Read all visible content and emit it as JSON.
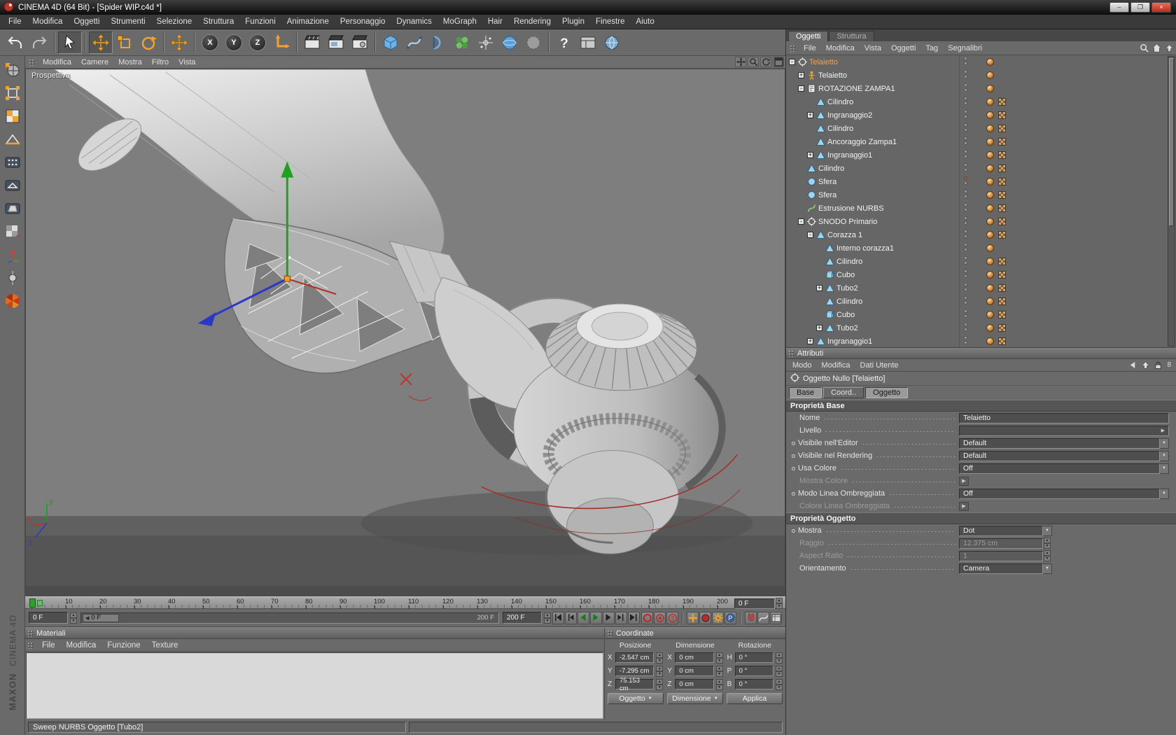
{
  "titlebar": {
    "title": "CINEMA 4D (64 Bit) - [Spider WIP.c4d *]",
    "window_buttons": [
      {
        "name": "minimize",
        "glyph": "–"
      },
      {
        "name": "restore",
        "glyph": "❐"
      },
      {
        "name": "close",
        "glyph": "×"
      }
    ]
  },
  "menubar": [
    "File",
    "Modifica",
    "Oggetti",
    "Strumenti",
    "Selezione",
    "Struttura",
    "Funzioni",
    "Animazione",
    "Personaggio",
    "Dynamics",
    "MoGraph",
    "Hair",
    "Rendering",
    "Plugin",
    "Finestre",
    "Aiuto"
  ],
  "toolbar": {
    "buttons": [
      {
        "name": "undo",
        "icon": "undo"
      },
      {
        "name": "redo",
        "icon": "redo"
      },
      {
        "sep": true
      },
      {
        "name": "live-selection",
        "icon": "cursor",
        "pressed": true
      },
      {
        "sep": true
      },
      {
        "name": "move-tool",
        "icon": "move",
        "pressed": true
      },
      {
        "name": "scale-tool",
        "icon": "scale"
      },
      {
        "name": "rotate-tool",
        "icon": "rotate"
      },
      {
        "sep": true
      },
      {
        "name": "last-tool",
        "icon": "move"
      },
      {
        "sep": true
      },
      {
        "name": "lock-x",
        "letter": "X"
      },
      {
        "name": "lock-y",
        "letter": "Y"
      },
      {
        "name": "lock-z",
        "letter": "Z"
      },
      {
        "name": "coord-system",
        "icon": "coordsys"
      },
      {
        "sep": true
      },
      {
        "name": "render-view",
        "icon": "clapper"
      },
      {
        "name": "render-picture-viewer",
        "icon": "clapper-pic"
      },
      {
        "name": "render-settings",
        "icon": "clapper-gear"
      },
      {
        "sep": true
      },
      {
        "name": "add-primitive",
        "icon": "cube"
      },
      {
        "name": "add-spline",
        "icon": "spline"
      },
      {
        "name": "add-nurbs",
        "icon": "nurbs"
      },
      {
        "name": "add-modeling",
        "icon": "modeling"
      },
      {
        "name": "add-particle",
        "icon": "particle"
      },
      {
        "name": "add-scene",
        "icon": "scene"
      },
      {
        "name": "add-deformer",
        "icon": "deformer"
      },
      {
        "sep": true
      },
      {
        "name": "help",
        "icon": "help"
      },
      {
        "name": "layout",
        "icon": "layout"
      },
      {
        "name": "content-browser",
        "icon": "globe"
      }
    ]
  },
  "left_toolbar": [
    "make-editable",
    "model-mode",
    "texture-mode",
    "workplane-mode",
    "points-mode",
    "edges-mode",
    "polygons-mode",
    "texture-axis-mode",
    "object-axis-mode",
    "keyframe-mode",
    "viewport-fan"
  ],
  "viewport": {
    "menu": [
      "Modifica",
      "Camere",
      "Mostra",
      "Filtro",
      "Vista"
    ],
    "view_icons": [
      "pan-view",
      "zoom-view",
      "rotate-view",
      "toggle-view"
    ],
    "camera_label": "Prospettiva"
  },
  "object_manager": {
    "tabs": [
      {
        "label": "Oggetti",
        "active": true
      },
      {
        "label": "Struttura",
        "active": false
      }
    ],
    "menu": [
      "File",
      "Modifica",
      "Vista",
      "Oggetti",
      "Tag",
      "Segnalibri"
    ],
    "corner_icons": [
      "search",
      "home",
      "up"
    ],
    "tree": [
      {
        "label": "Telaietto",
        "depth": 0,
        "expand": "-",
        "icon": "null",
        "selected": true,
        "tags": [
          "material"
        ]
      },
      {
        "label": "Telaietto",
        "depth": 1,
        "expand": "+",
        "icon": "figure",
        "tags": [
          "material"
        ]
      },
      {
        "label": "ROTAZIONE ZAMPA1",
        "depth": 1,
        "expand": "-",
        "icon": "note",
        "tags": [
          "material"
        ]
      },
      {
        "label": "Cilindro",
        "depth": 2,
        "icon": "cone",
        "tags": [
          "material",
          "uvw"
        ]
      },
      {
        "label": "Ingranaggio2",
        "depth": 2,
        "expand": "+",
        "icon": "cone",
        "tags": [
          "material",
          "uvw"
        ]
      },
      {
        "label": "Cilindro",
        "depth": 2,
        "icon": "cone",
        "tags": [
          "material",
          "uvw"
        ]
      },
      {
        "label": "Ancoraggio Zampa1",
        "depth": 2,
        "icon": "cone",
        "tags": [
          "material",
          "uvw"
        ]
      },
      {
        "label": "Ingranaggio1",
        "depth": 2,
        "expand": "+",
        "icon": "cone",
        "tags": [
          "material",
          "uvw"
        ]
      },
      {
        "label": "Cilindro",
        "depth": 1,
        "icon": "cone",
        "tags": [
          "material",
          "uvw"
        ]
      },
      {
        "label": "Sfera",
        "depth": 1,
        "icon": "sphere",
        "dot": "red",
        "tags": [
          "material",
          "uvw"
        ]
      },
      {
        "label": "Sfera",
        "depth": 1,
        "icon": "sphere",
        "tags": [
          "material",
          "uvw"
        ]
      },
      {
        "label": "Estrusione NURBS",
        "depth": 1,
        "icon": "nurbs",
        "tags": [
          "material",
          "uvw"
        ]
      },
      {
        "label": "SNODO Primario",
        "depth": 1,
        "expand": "-",
        "icon": "null",
        "tags": [
          "material",
          "uvw"
        ]
      },
      {
        "label": "Corazza 1",
        "depth": 2,
        "expand": "-",
        "icon": "cone",
        "tags": [
          "material",
          "uvw"
        ]
      },
      {
        "label": "Interno corazza1",
        "depth": 3,
        "icon": "cone",
        "tags": [
          "material"
        ]
      },
      {
        "label": "Cilindro",
        "depth": 3,
        "icon": "cone",
        "tags": [
          "material",
          "uvw"
        ]
      },
      {
        "label": "Cubo",
        "depth": 3,
        "icon": "cube",
        "tags": [
          "material",
          "uvw"
        ]
      },
      {
        "label": "Tubo2",
        "depth": 3,
        "expand": "+",
        "icon": "cone",
        "tags": [
          "material",
          "uvw"
        ]
      },
      {
        "label": "Cilindro",
        "depth": 3,
        "icon": "cone",
        "tags": [
          "material",
          "uvw"
        ]
      },
      {
        "label": "Cubo",
        "depth": 3,
        "icon": "cube",
        "tags": [
          "material",
          "uvw"
        ]
      },
      {
        "label": "Tubo2",
        "depth": 3,
        "expand": "+",
        "icon": "cone",
        "tags": [
          "material",
          "uvw"
        ]
      },
      {
        "label": "Ingranaggio1",
        "depth": 2,
        "expand": "+",
        "icon": "cone",
        "tags": [
          "material",
          "uvw"
        ]
      }
    ]
  },
  "attributes": {
    "panel_title": "Attributi",
    "menu": [
      "Modo",
      "Modifica",
      "Dati Utente"
    ],
    "header_icons": [
      "back",
      "up",
      "lock"
    ],
    "header_badge": "8",
    "object_title": "Oggetto Nullo [Telaietto]",
    "tabs": [
      {
        "label": "Base",
        "active": true
      },
      {
        "label": "Coord..",
        "active": false
      },
      {
        "label": "Oggetto",
        "active": true
      }
    ],
    "sections": [
      {
        "title": "Proprietà Base",
        "rows": [
          {
            "label": "Nome",
            "type": "text",
            "value": "Telaietto"
          },
          {
            "label": "Livello",
            "type": "level",
            "value": ""
          },
          {
            "label": "Visibile nell'Editor",
            "type": "dropdown",
            "value": "Default",
            "bullet": true
          },
          {
            "label": "Visibile nel Rendering",
            "type": "dropdown",
            "value": "Default",
            "bullet": true
          },
          {
            "label": "Usa Colore",
            "type": "dropdown",
            "value": "Off",
            "bullet": true
          },
          {
            "label": "Mostra Colore",
            "type": "flyout",
            "disabled": true
          },
          {
            "label": "Modo Linea Ombreggiata",
            "type": "dropdown",
            "value": "Off",
            "bullet": true
          },
          {
            "label": "Colore Linea Ombreggiata",
            "type": "flyout",
            "disabled": true
          }
        ]
      },
      {
        "title": "Proprietà Oggetto",
        "rows": [
          {
            "label": "Mostra",
            "type": "dropdown",
            "value": "Dot",
            "bullet": true,
            "short": true
          },
          {
            "label": "Raggio",
            "type": "number",
            "value": "12.375 cm",
            "disabled": true,
            "short": true
          },
          {
            "label": "Aspect Ratio",
            "type": "number",
            "value": "1",
            "disabled": true,
            "short": true
          },
          {
            "label": "Orientamento",
            "type": "dropdown",
            "value": "Camera",
            "short": true
          }
        ]
      }
    ]
  },
  "timeline": {
    "ticks": [
      "0",
      "10",
      "20",
      "30",
      "40",
      "50",
      "60",
      "70",
      "80",
      "90",
      "100",
      "110",
      "120",
      "130",
      "140",
      "150",
      "160",
      "170",
      "180",
      "190",
      "200"
    ],
    "ruler_end_field": "0 F",
    "frame_field": "0 F",
    "slider_handle": "0 F",
    "range_label": "200 F",
    "range_field": "200 F",
    "transport": [
      "goto-start",
      "prev-key",
      "prev-frame",
      "play",
      "next-frame",
      "next-key",
      "goto-end"
    ],
    "record_buttons": [
      "record-position",
      "record-keyframe",
      "record-help"
    ],
    "anim_buttons": [
      "set-keyframe",
      "autokey",
      "keying-options",
      "playback-mode"
    ],
    "extra_buttons": [
      "snap",
      "fcurve",
      "timeline-sheet"
    ],
    "p_label": "P"
  },
  "materials": {
    "panel_title": "Materiali",
    "menu": [
      "File",
      "Modifica",
      "Funzione",
      "Texture"
    ]
  },
  "coordinates": {
    "panel_title": "Coordinate",
    "groups": [
      {
        "header": "Posizione",
        "rows": [
          {
            "label": "X",
            "value": "-2.547 cm"
          },
          {
            "label": "Y",
            "value": "-7.295 cm"
          },
          {
            "label": "Z",
            "value": "75.153 cm"
          }
        ]
      },
      {
        "header": "Dimensione",
        "rows": [
          {
            "label": "X",
            "value": "0 cm"
          },
          {
            "label": "Y",
            "value": "0 cm"
          },
          {
            "label": "Z",
            "value": "0 cm"
          }
        ]
      },
      {
        "header": "Rotazione",
        "rows": [
          {
            "label": "H",
            "value": "0 °"
          },
          {
            "label": "P",
            "value": "0 °"
          },
          {
            "label": "B",
            "value": "0 °"
          }
        ]
      }
    ],
    "footer_buttons": [
      {
        "label": "Oggetto",
        "dropdown": true
      },
      {
        "label": "Dimensione",
        "dropdown": true
      },
      {
        "label": "Applica",
        "dropdown": false
      }
    ]
  },
  "statusbar": {
    "text": "Sweep NURBS Oggetto [Tubo2]"
  },
  "branding": {
    "line1": "MAXON",
    "line2": "CINEMA 4D"
  },
  "colors": {
    "accent_orange": "#f0a232",
    "selection_text": "#f2a24c",
    "axis_x": "#c03028",
    "axis_y": "#1fa01f",
    "axis_z": "#2a38c8",
    "viewport_bg": "#7e7e7e"
  }
}
